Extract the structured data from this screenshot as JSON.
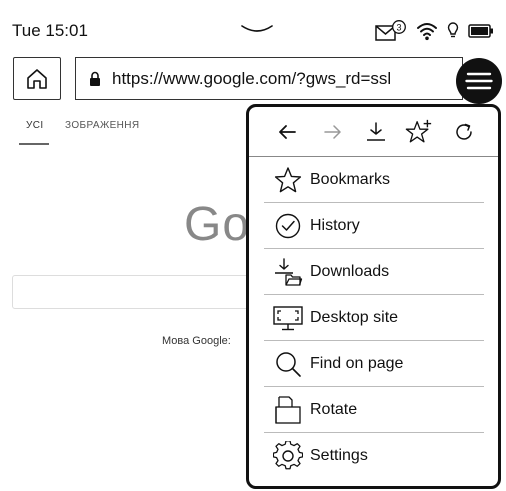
{
  "status_bar": {
    "time": "Tue 15:01",
    "mail_badge": "3",
    "icons": [
      "chevron-down-icon",
      "mail-icon",
      "wifi-icon",
      "light-bulb-icon",
      "battery-icon"
    ]
  },
  "nav_bar": {
    "url": "https://www.google.com/?gws_rd=ssl",
    "home_icon": "home-icon",
    "lock_icon": "lock-icon",
    "menu_icon": "hamburger-menu-icon"
  },
  "page": {
    "tab_all": "УСІ",
    "tab_images": "ЗОБРАЖЕННЯ",
    "logo_text": "Go",
    "language_label": "Мова Google:"
  },
  "menu": {
    "toolbar": [
      "back-arrow-icon",
      "forward-arrow-icon",
      "download-icon",
      "add-bookmark-icon",
      "reload-icon"
    ],
    "items": [
      {
        "label": "Bookmarks",
        "icon": "star-icon"
      },
      {
        "label": "History",
        "icon": "clock-check-icon"
      },
      {
        "label": "Downloads",
        "icon": "downloads-folder-icon"
      },
      {
        "label": "Desktop site",
        "icon": "desktop-monitor-icon"
      },
      {
        "label": "Find on page",
        "icon": "search-icon"
      },
      {
        "label": "Rotate",
        "icon": "rotate-icon"
      },
      {
        "label": "Settings",
        "icon": "gear-icon"
      }
    ]
  },
  "colors": {
    "ink": "#111111",
    "logo_gray": "#888888",
    "divider": "#bbbbbb"
  }
}
